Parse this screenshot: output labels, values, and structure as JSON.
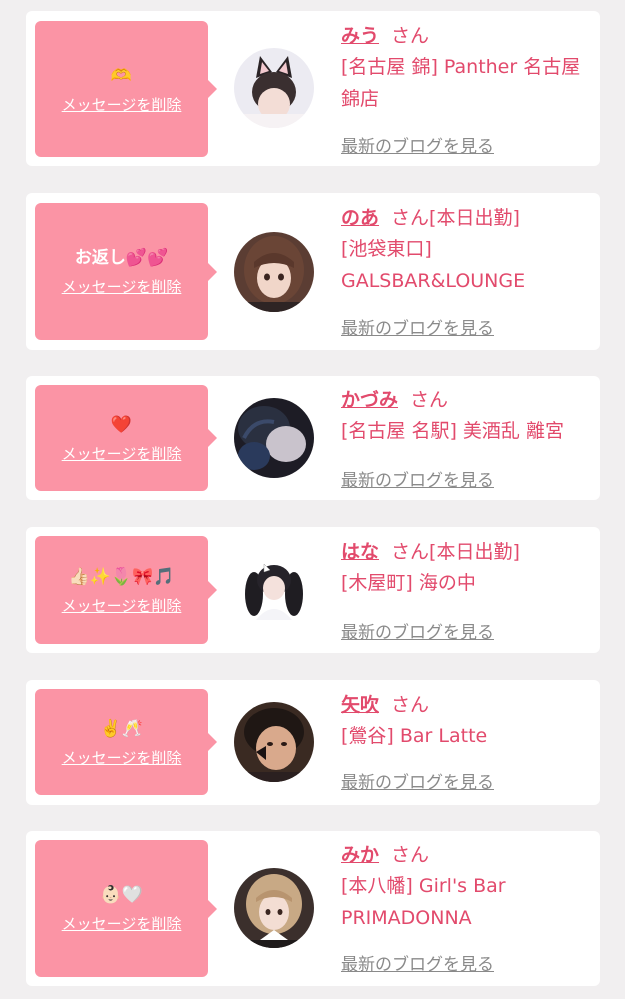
{
  "colors": {
    "accent": "#fb94a5",
    "name_text": "#e24a6c",
    "link_gray": "#8a8a8a",
    "background": "#f1eff0"
  },
  "items": [
    {
      "message": "🫶",
      "delete_label": "メッセージを削除",
      "name": "みう",
      "honorific": "さん",
      "status": "",
      "shop": "[名古屋 錦] Panther 名古屋 錦店",
      "blog_label": "最新のブログを見る",
      "avatar": "cat-ear-girl-avatar"
    },
    {
      "message": "お返し💕💕",
      "delete_label": "メッセージを削除",
      "name": "のあ",
      "honorific": "さん",
      "status": "[本日出勤]",
      "shop": "[池袋東口] GALSBAR&LOUNGE",
      "blog_label": "最新のブログを見る",
      "avatar": "brown-hair-girl-avatar"
    },
    {
      "message": "❤️",
      "delete_label": "メッセージを削除",
      "name": "かづみ",
      "honorific": "さん",
      "status": "",
      "shop": "[名古屋 名駅] 美酒乱 離宮",
      "blog_label": "最新のブログを見る",
      "avatar": "dark-photo-avatar"
    },
    {
      "message": "👍🏻✨🌷🎀🎵",
      "delete_label": "メッセージを削除",
      "name": "はな",
      "honorific": "さん",
      "status": "[本日出勤]",
      "shop": "[木屋町] 海の中",
      "blog_label": "最新のブログを見る",
      "avatar": "twin-tail-girl-avatar"
    },
    {
      "message": "✌️🥂",
      "delete_label": "メッセージを削除",
      "name": "矢吹",
      "honorific": "さん",
      "status": "",
      "shop": "[鶯谷] Bar Latte",
      "blog_label": "最新のブログを見る",
      "avatar": "face-sticker-avatar"
    },
    {
      "message": "👶🏻🤍",
      "delete_label": "メッセージを削除",
      "name": "みか",
      "honorific": "さん",
      "status": "",
      "shop": "[本八幡] Girl's Bar PRIMADONNA",
      "blog_label": "最新のブログを見る",
      "avatar": "blonde-girl-avatar"
    }
  ]
}
